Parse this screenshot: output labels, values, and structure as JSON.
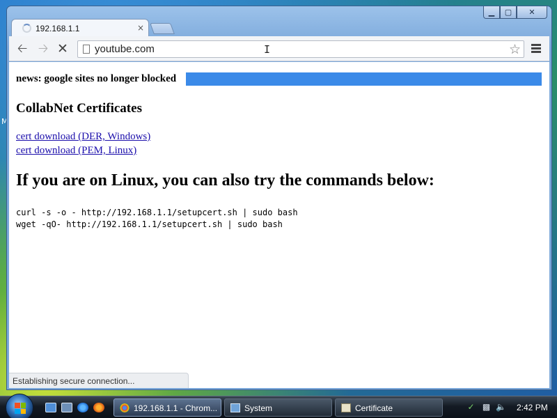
{
  "desktop": {
    "edge_text": "M"
  },
  "window": {
    "controls": {
      "minimize": "▁",
      "maximize": "▢",
      "close": "✕"
    },
    "tab": {
      "title": "192.168.1.1",
      "close": "×"
    },
    "toolbar": {
      "back_icon": "back-arrow-icon",
      "forward_icon": "forward-arrow-icon",
      "stop_icon": "stop-icon",
      "url": "youtube.com",
      "bookmark_icon": "star-icon",
      "menu_icon": "hamburger-menu-icon"
    },
    "status": "Establishing secure connection..."
  },
  "page": {
    "news": "news: google sites no longer blocked",
    "highlight_color": "#3b8ae8",
    "heading_certs": "CollabNet Certificates",
    "links": [
      {
        "label": "cert download (DER, Windows)"
      },
      {
        "label": "cert download (PEM, Linux)"
      }
    ],
    "heading_linux": "If you are on Linux, you can also try the commands below:",
    "commands": [
      "curl -s -o - http://192.168.1.1/setupcert.sh | sudo bash",
      "wget -qO- http://192.168.1.1/setupcert.sh | sudo bash"
    ]
  },
  "taskbar": {
    "tasks": [
      {
        "label": "192.168.1.1 - Chrom...",
        "active": true
      },
      {
        "label": "System",
        "active": false
      },
      {
        "label": "Certificate",
        "active": false
      }
    ],
    "clock": "2:42 PM"
  }
}
